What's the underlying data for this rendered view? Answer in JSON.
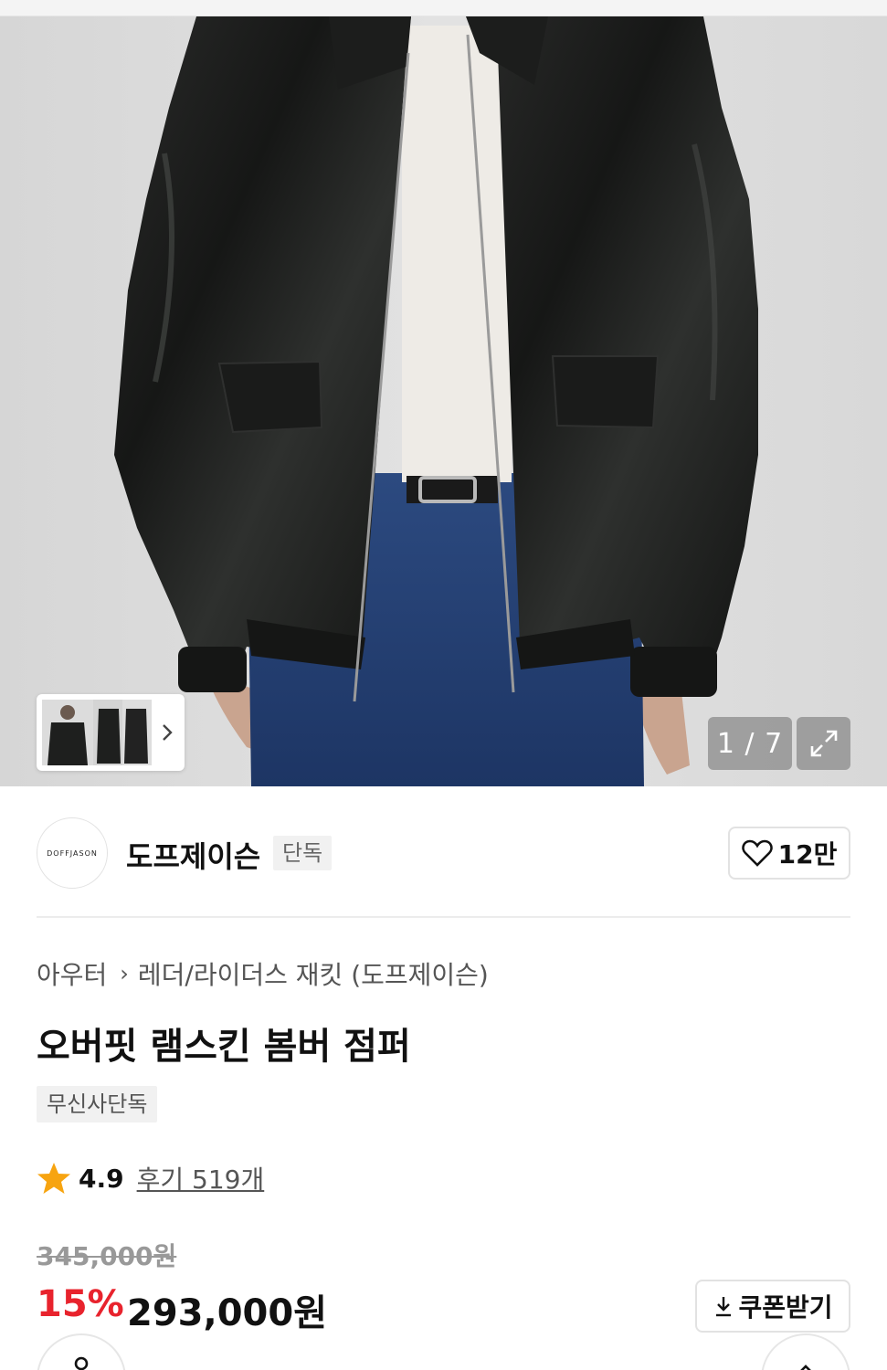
{
  "gallery": {
    "counter": "1 / 7",
    "current_index": 1,
    "total_images": 7
  },
  "brand": {
    "logo_text": "DOFFJASON",
    "name": "도프제이슨",
    "tag": "단독",
    "like_count": "12만"
  },
  "breadcrumb": {
    "category": "아우터",
    "subcategory": "레더/라이더스 재킷 (도프제이슨)"
  },
  "product": {
    "title": "오버핏 램스킨 봄버 점퍼",
    "badge": "무신사단독"
  },
  "rating": {
    "score": "4.9",
    "reviews_label": "후기 519개"
  },
  "price": {
    "original": "345,000원",
    "discount": "15%",
    "sale": "293,000원",
    "coupon_label": "쿠폰받기"
  },
  "colors": {
    "discount": "#e8232d",
    "star": "#f7a410"
  },
  "icons": {
    "like": "heart-icon",
    "expand": "expand-icon",
    "next": "chevron-right-icon",
    "coupon": "download-icon",
    "share": "share-icon",
    "top": "arrow-up-icon"
  }
}
